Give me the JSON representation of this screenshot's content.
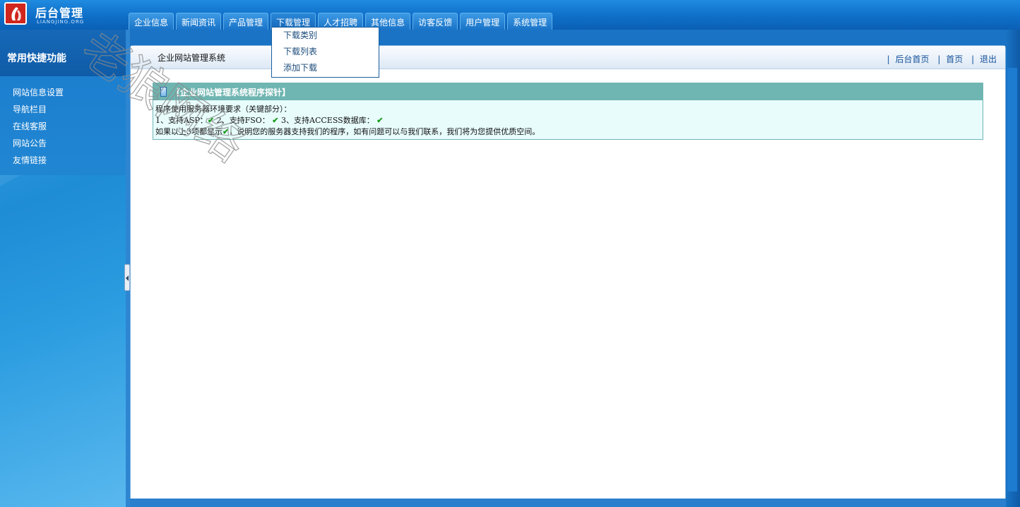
{
  "logo": {
    "title": "后台管理",
    "subtitle": "LIANGJING.ORG"
  },
  "nav": {
    "tabs": [
      {
        "label": "企业信息"
      },
      {
        "label": "新闻资讯"
      },
      {
        "label": "产品管理"
      },
      {
        "label": "下载管理"
      },
      {
        "label": "人才招聘"
      },
      {
        "label": "其他信息"
      },
      {
        "label": "访客反馈"
      },
      {
        "label": "用户管理"
      },
      {
        "label": "系统管理"
      }
    ],
    "dropdown": [
      "下载类别",
      "下载列表",
      "添加下载"
    ]
  },
  "sidebar": {
    "header": "常用快捷功能",
    "items": [
      "网站信息设置",
      "导航栏目",
      "在线客服",
      "网站公告",
      "友情链接"
    ]
  },
  "main": {
    "title": "企业网站管理系统",
    "links": [
      "后台首页",
      "首页",
      "退出"
    ],
    "separator": "|"
  },
  "probe": {
    "title": "【企业网站管理系统程序探针】",
    "line1": "程序使用服务器环境要求（关键部分）：",
    "line2_a": "1、支持ASP：",
    "line2_b": " 2、支持FSO：",
    "line2_c": " 3、支持ACCESS数据库：",
    "line3_a": "如果以上3项都显示",
    "line3_b": "，说明您的服务器支持我们的程序，如有问题可以与我们联系，我们将为您提供优质空间。",
    "check": "✔"
  },
  "watermark": "老狼网络",
  "colors": {
    "accent": "#1a73c4",
    "probe_header": "#6fb5b1",
    "probe_bg": "#e8fcfc"
  }
}
